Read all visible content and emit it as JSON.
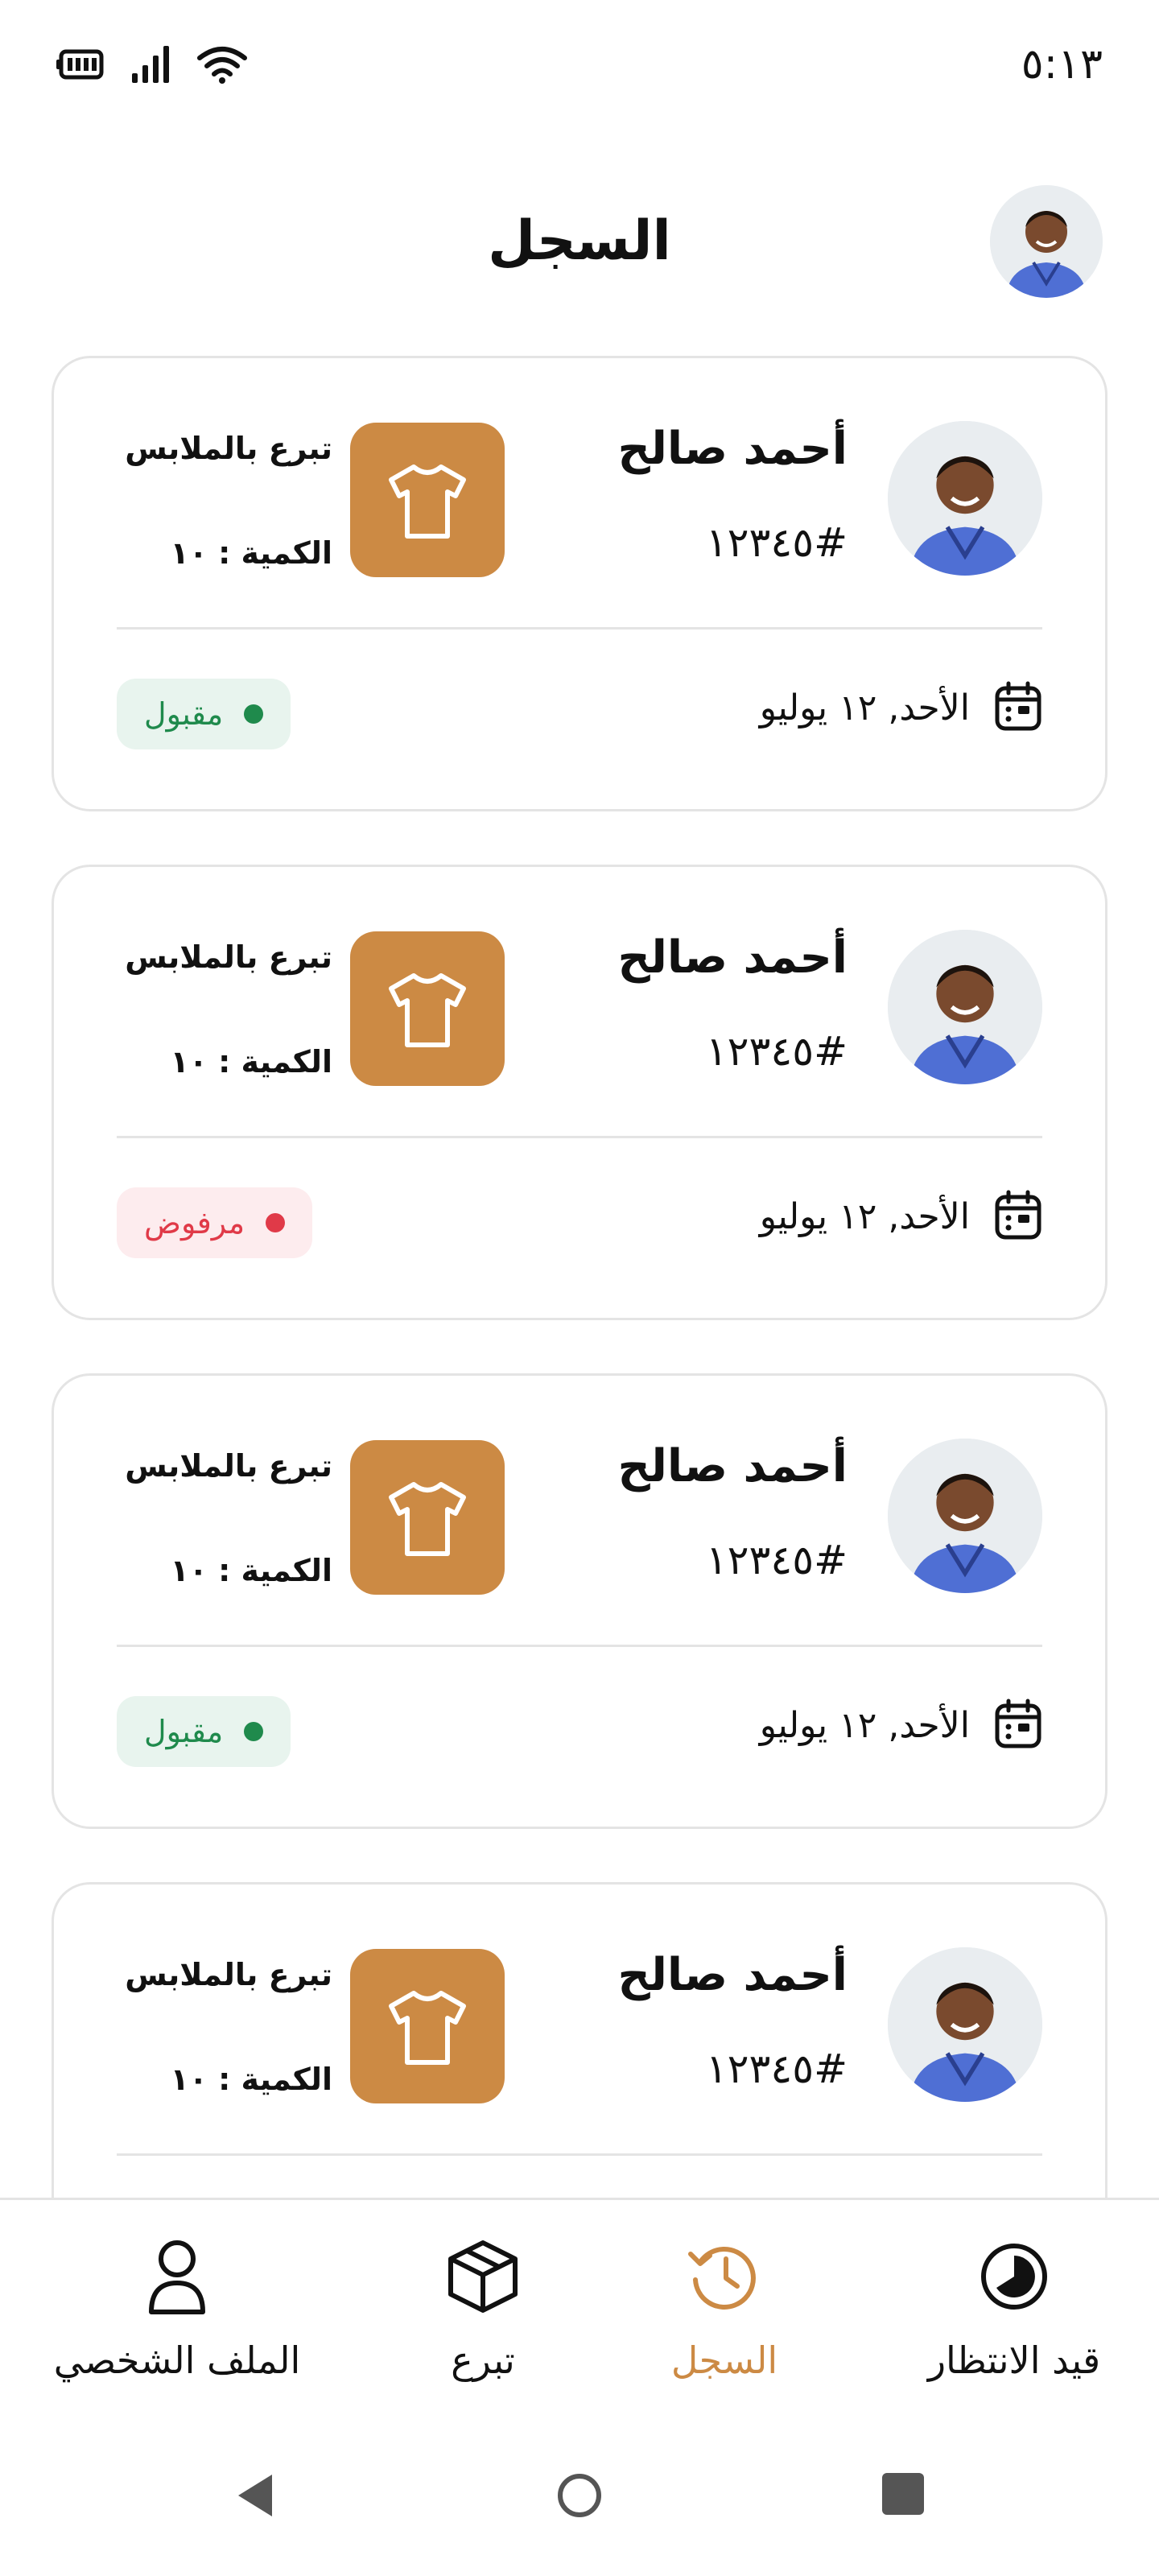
{
  "status_bar": {
    "time": "٥:١٣"
  },
  "header": {
    "title": "السجل"
  },
  "cards": [
    {
      "name": "أحمد صالح",
      "id": "#١٢٣٤٥",
      "type": "تبرع بالملابس",
      "quantity": "الكمية : ١٠",
      "date": "الأحد, ١٢ يوليو",
      "status": "مقبول",
      "status_kind": "accepted"
    },
    {
      "name": "أحمد صالح",
      "id": "#١٢٣٤٥",
      "type": "تبرع بالملابس",
      "quantity": "الكمية : ١٠",
      "date": "الأحد, ١٢ يوليو",
      "status": "مرفوض",
      "status_kind": "rejected"
    },
    {
      "name": "أحمد صالح",
      "id": "#١٢٣٤٥",
      "type": "تبرع بالملابس",
      "quantity": "الكمية : ١٠",
      "date": "الأحد, ١٢ يوليو",
      "status": "مقبول",
      "status_kind": "accepted"
    },
    {
      "name": "أحمد صالح",
      "id": "#١٢٣٤٥",
      "type": "تبرع بالملابس",
      "quantity": "الكمية : ١٠",
      "date": "",
      "status": "",
      "status_kind": ""
    }
  ],
  "bottom_nav": {
    "items": [
      {
        "label": "الملف الشخصي",
        "icon": "user-icon"
      },
      {
        "label": "تبرع",
        "icon": "box-icon"
      },
      {
        "label": "السجل",
        "icon": "history-icon",
        "active": true
      },
      {
        "label": "قيد الانتظار",
        "icon": "pending-icon"
      }
    ]
  },
  "colors": {
    "accent": "#cc8a44",
    "accepted": "#1f8a4c",
    "rejected": "#e03a48"
  }
}
